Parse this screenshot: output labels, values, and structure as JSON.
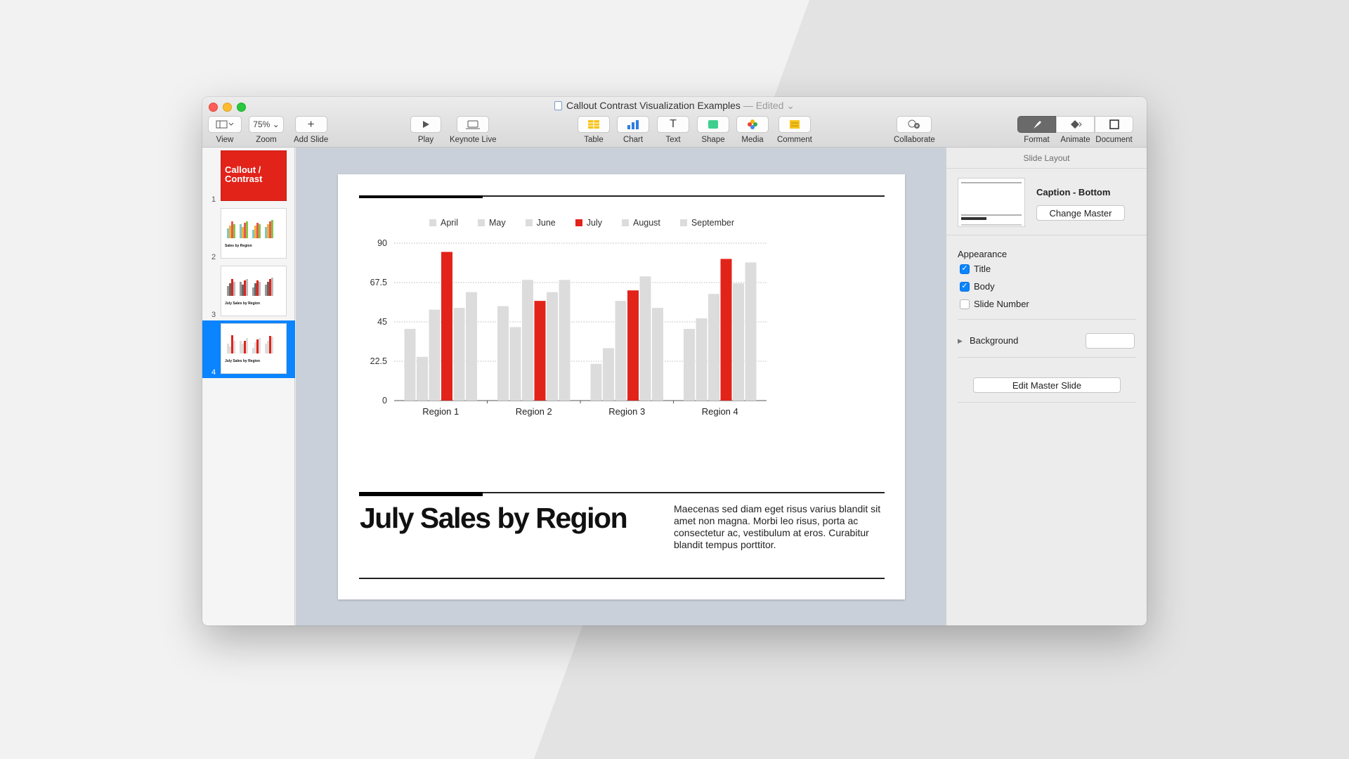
{
  "window": {
    "title": "Callout Contrast Visualization Examples",
    "title_suffix": "— Edited ⌄"
  },
  "toolbar": {
    "view_label": "View",
    "zoom_value": "75% ⌄",
    "zoom_label": "Zoom",
    "add_slide_label": "Add Slide",
    "play_label": "Play",
    "keynote_live_label": "Keynote Live",
    "table_label": "Table",
    "chart_label": "Chart",
    "text_label": "Text",
    "shape_label": "Shape",
    "media_label": "Media",
    "comment_label": "Comment",
    "collaborate_label": "Collaborate",
    "format_label": "Format",
    "animate_label": "Animate",
    "document_label": "Document"
  },
  "navigator": {
    "slides": [
      {
        "number": "1",
        "title": "Callout / Contrast"
      },
      {
        "number": "2",
        "title": "Sales by Region"
      },
      {
        "number": "3",
        "title": "July Sales by Region"
      },
      {
        "number": "4",
        "title": "July Sales by Region"
      }
    ],
    "selected": 4
  },
  "slide": {
    "title": "July Sales by Region",
    "body": "Maecenas sed diam eget risus varius blandit sit amet non magna. Morbi leo risus, porta ac consectetur ac, vestibulum at eros. Curabitur blandit tempus porttitor."
  },
  "chart_data": {
    "type": "bar",
    "title": "",
    "xlabel": "",
    "ylabel": "",
    "ylim": [
      0,
      90
    ],
    "yticks": [
      "0",
      "22.5",
      "45",
      "67.5",
      "90"
    ],
    "grid": true,
    "legend_position": "top",
    "categories": [
      "Region 1",
      "Region 2",
      "Region 3",
      "Region 4"
    ],
    "highlight_color": "#e2231a",
    "muted_color": "#dcdcdc",
    "series": [
      {
        "name": "April",
        "values": [
          41,
          54,
          21,
          41
        ]
      },
      {
        "name": "May",
        "values": [
          25,
          42,
          30,
          47
        ]
      },
      {
        "name": "June",
        "values": [
          52,
          69,
          57,
          61
        ]
      },
      {
        "name": "July",
        "values": [
          85,
          57,
          63,
          81
        ],
        "highlight": true
      },
      {
        "name": "August",
        "values": [
          53,
          62,
          71,
          67
        ]
      },
      {
        "name": "September",
        "values": [
          62,
          69,
          53,
          79
        ]
      }
    ]
  },
  "inspector": {
    "header": "Slide Layout",
    "layout_name": "Caption - Bottom",
    "change_master_label": "Change Master",
    "appearance_label": "Appearance",
    "title_checkbox_label": "Title",
    "title_checked": true,
    "body_checkbox_label": "Body",
    "body_checked": true,
    "slide_number_label": "Slide Number",
    "slide_number_checked": false,
    "background_label": "Background",
    "edit_master_label": "Edit Master Slide"
  },
  "colors": {
    "accent": "#0a84ff",
    "highlight": "#e2231a"
  }
}
